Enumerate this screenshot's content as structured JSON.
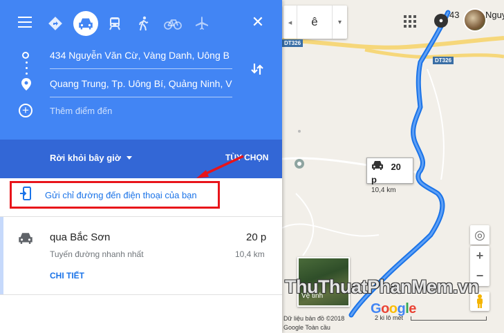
{
  "panel": {
    "travel_modes": [
      {
        "name": "best-route",
        "active": false
      },
      {
        "name": "drive",
        "active": true
      },
      {
        "name": "transit",
        "active": false
      },
      {
        "name": "walk",
        "active": false
      },
      {
        "name": "bicycle",
        "active": false
      },
      {
        "name": "flight",
        "active": false
      }
    ],
    "origin": "434 Nguyễn Văn Cừ, Vàng Danh, Uông B",
    "destination": "Quang Trung, Tp. Uông Bí, Quảng Ninh, V",
    "add_destination_placeholder": "Thêm điểm đến",
    "leave_now": "Rời khỏi bây giờ",
    "options": "TÙY CHỌN",
    "send_to_phone": "Gửi chỉ đường đến điện thoại của bạn",
    "route": {
      "via": "qua Bắc Sơn",
      "time": "20 p",
      "description": "Tuyến đường nhanh nhất",
      "distance": "10,4 km",
      "details": "CHI TIẾT"
    }
  },
  "map": {
    "search_text": "ê",
    "user_label": "43",
    "user_name": "Nguyễ",
    "road_labels": [
      "DT326",
      "DT326"
    ],
    "eta_time": "20 p",
    "eta_distance": "10,4 km",
    "satellite_label": "Vệ tinh",
    "google": "Google",
    "attribution": "Dữ liệu bản đồ ©2018",
    "attribution2": "Google  Toàn cầu",
    "scale": "2 ki lô mét",
    "route_color": "#1a73e8"
  },
  "watermark": {
    "part1": "Thu",
    "part2": "Thuat",
    "part3": "PhanMem",
    "part4": ".vn"
  },
  "colors": {
    "panel_blue": "#4285f4",
    "panel_blue_dark": "#3367d6",
    "highlight_red": "#e8141a",
    "link_blue": "#1a73e8"
  }
}
